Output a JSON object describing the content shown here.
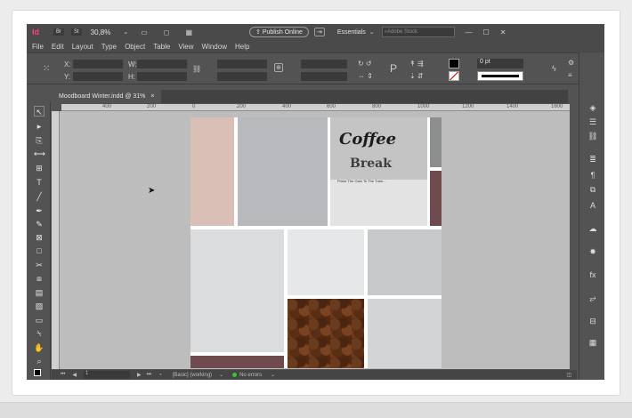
{
  "app": {
    "logo": "Id",
    "bridge": "Br",
    "stock": "St",
    "zoom": "30,8%",
    "publish_label": "Publish Online",
    "workspace": "Essentials",
    "search_placeholder": "Adobe Stock"
  },
  "menu": [
    "File",
    "Edit",
    "Layout",
    "Type",
    "Object",
    "Table",
    "View",
    "Window",
    "Help"
  ],
  "control": {
    "x_label": "X:",
    "y_label": "Y:",
    "w_label": "W:",
    "h_label": "H:",
    "stroke_weight": "0 pt"
  },
  "document": {
    "tab_title": "Moodboard Winter.indd @ 31%",
    "tab_close": "×"
  },
  "ruler": {
    "h_ticks": [
      "400",
      "200",
      "0",
      "200",
      "400",
      "600",
      "800",
      "1000",
      "1200",
      "1400",
      "1600"
    ]
  },
  "moodboard": {
    "coffee_title": "Coffee",
    "coffee_subtitle": "Break",
    "coffee_tagline": "Prime The Gain To The Train..."
  },
  "status": {
    "page": "1",
    "preflight_profile": "[Basic] (working)",
    "errors": "No errors"
  },
  "colors": {
    "swatch_blush": "#d9bfb6",
    "swatch_slate": "#b8b9bd",
    "swatch_mist": "#dadcde",
    "swatch_wine": "#6f4a4f",
    "swatch_stone": "#c7c8ca",
    "error_ok": "#3cc13c"
  }
}
